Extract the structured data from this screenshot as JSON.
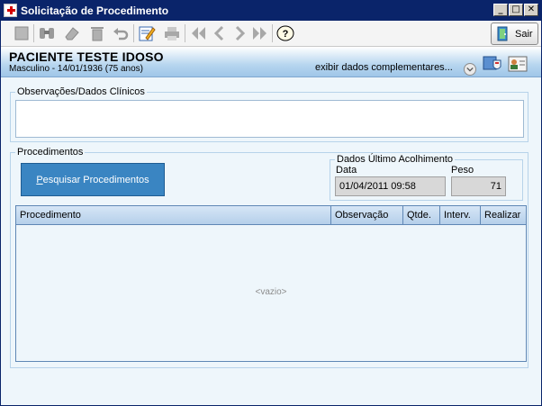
{
  "window": {
    "title": "Solicitação de Procedimento",
    "buttons": {
      "minimize": "_",
      "maximize": "□",
      "close": "✕"
    }
  },
  "toolbar": {
    "icons": [
      "new-icon",
      "binoculars-icon",
      "eraser-icon",
      "trash-icon",
      "undo-icon",
      "edit-icon",
      "print-icon",
      "first-icon",
      "previous-icon",
      "next-icon",
      "last-icon",
      "help-icon"
    ],
    "exit_label": "Sair"
  },
  "patient": {
    "name": "PACIENTE TESTE IDOSO",
    "info": "Masculino - 14/01/1936 (75 anos)",
    "extra_link": "exibir dados complementares..."
  },
  "observations": {
    "legend": "Observações/Dados Clínicos",
    "value": ""
  },
  "procedures": {
    "legend": "Procedimentos",
    "search_button": "Pesquisar Procedimentos",
    "search_button_accel": "P",
    "search_button_rest": "esquisar Procedimentos"
  },
  "last_reception": {
    "legend": "Dados Último Acolhimento",
    "date_label": "Data",
    "date_value": "01/04/2011 09:58",
    "weight_label": "Peso",
    "weight_value": "71"
  },
  "grid": {
    "columns": [
      "Procedimento",
      "Observação",
      "Qtde.",
      "Interv.",
      "Realizar"
    ],
    "empty_text": "<vazio>"
  },
  "colors": {
    "title_bar": "#0a246a",
    "accent_button": "#3a85c2",
    "panel_background": "#eef6fb"
  }
}
